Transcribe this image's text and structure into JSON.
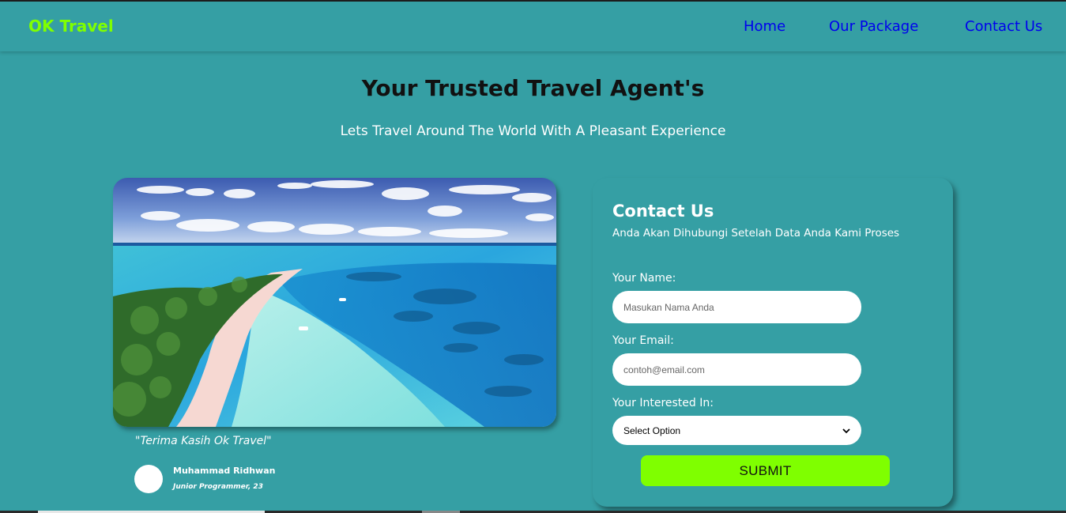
{
  "brand": {
    "name": "OK Travel",
    "color": "#7fff00"
  },
  "nav": {
    "items": [
      {
        "label": "Home"
      },
      {
        "label": "Our Package"
      },
      {
        "label": "Contact Us"
      }
    ],
    "link_color": "#0000ee"
  },
  "hero": {
    "title": "Your Trusted Travel Agent's",
    "subtitle": "Lets Travel Around The World With A Pleasant Experience"
  },
  "testimonial": {
    "image_icon": "tropical-island-photo",
    "quote": "\"Terima Kasih Ok Travel\"",
    "name": "Muhammad Ridhwan",
    "role": "Junior Programmer, 23"
  },
  "contact": {
    "title": "Contact Us",
    "subtitle": "Anda Akan Dihubungi Setelah Data Anda Kami Proses",
    "name_label": "Your Name:",
    "name_placeholder": "Masukan Nama Anda",
    "email_label": "Your Email:",
    "email_placeholder": "contoh@email.com",
    "interest_label": "Your Interested In:",
    "interest_selected": "Select Option",
    "submit_label": "SUBMIT",
    "submit_color": "#7fff00"
  },
  "theme": {
    "background": "#359fa4"
  }
}
